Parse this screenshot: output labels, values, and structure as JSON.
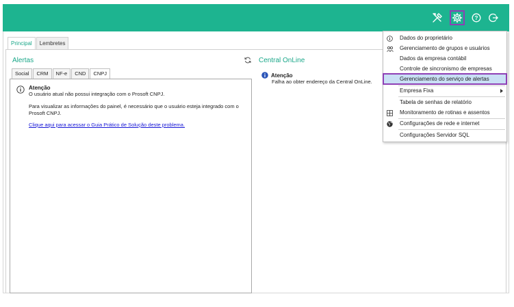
{
  "topbar": {
    "color": "#1db490",
    "icons": [
      "tools-icon",
      "gear-icon",
      "help-icon",
      "logout-icon"
    ]
  },
  "tabs": {
    "main": [
      "Principal",
      "Lembretes"
    ],
    "selected": "Principal"
  },
  "alertas": {
    "title": "Alertas",
    "subtabs": [
      "Social",
      "CRM",
      "NF-e",
      "CND",
      "CNPJ"
    ],
    "selected_subtab": "CNPJ",
    "message": {
      "title": "Atenção",
      "line1": "O usuário atual não possui integração com o Prosoft CNPJ.",
      "line2": "Para visualizar as informações do painel, é necessário que o usuário esteja integrado com o Prosoft CNPJ.",
      "link": "Clique aqui para acessar o Guia Prático de Solução deste problema."
    }
  },
  "central": {
    "title": "Central OnLine",
    "message_title": "Atenção",
    "message": "Falha ao obter endereço da Central OnLine."
  },
  "menu": {
    "items": [
      {
        "label": "Dados do proprietário",
        "icon": "info-icon"
      },
      {
        "label": "Gerenciamento de grupos e usuários",
        "icon": "users-icon"
      },
      {
        "label": "Dados da empresa contábil",
        "icon": ""
      },
      {
        "label": "Controle de sincronismo de empresas",
        "icon": ""
      },
      {
        "label": "Gerenciamento do serviço de alertas",
        "icon": ""
      },
      {
        "label": "Empresa Fixa",
        "icon": ""
      },
      {
        "label": "Tabela de senhas de relatório",
        "icon": ""
      },
      {
        "label": "Monitoramento de rotinas e assentos",
        "icon": "monitor-icon"
      },
      {
        "label": "Configurações de rede e internet",
        "icon": "globe-icon"
      },
      {
        "label": "Configurações Servidor SQL",
        "icon": ""
      }
    ],
    "highlighted": "Gerenciamento do serviço de alertas",
    "highlight_color": "#c9dff5",
    "highlight_border": "#8e3fb5"
  }
}
